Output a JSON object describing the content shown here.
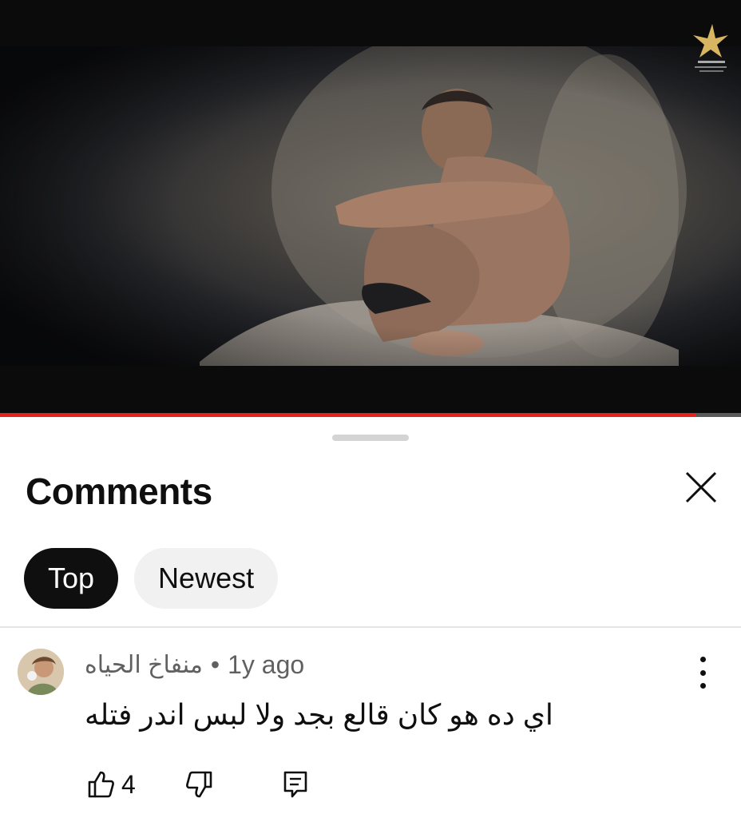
{
  "video": {
    "progress": 0.94
  },
  "comments_panel": {
    "title": "Comments",
    "close_icon": "close-icon",
    "chips": [
      {
        "label": "Top",
        "selected": true
      },
      {
        "label": "Newest",
        "selected": false
      }
    ],
    "comment": {
      "author": "منفاخ الحياه",
      "separator": "•",
      "time": "1y ago",
      "text": "اي ده هو كان قالع بجد ولا لبس اندر فتله",
      "like_count": "4",
      "icons": [
        "thumbs-up-icon",
        "thumbs-down-icon",
        "reply-icon",
        "more-vertical-icon"
      ]
    }
  },
  "colors": {
    "progress": "#e3231c",
    "chip_active_bg": "#0f0f0f",
    "chip_inactive_bg": "#f1f1f1",
    "meta_text": "#606060"
  }
}
